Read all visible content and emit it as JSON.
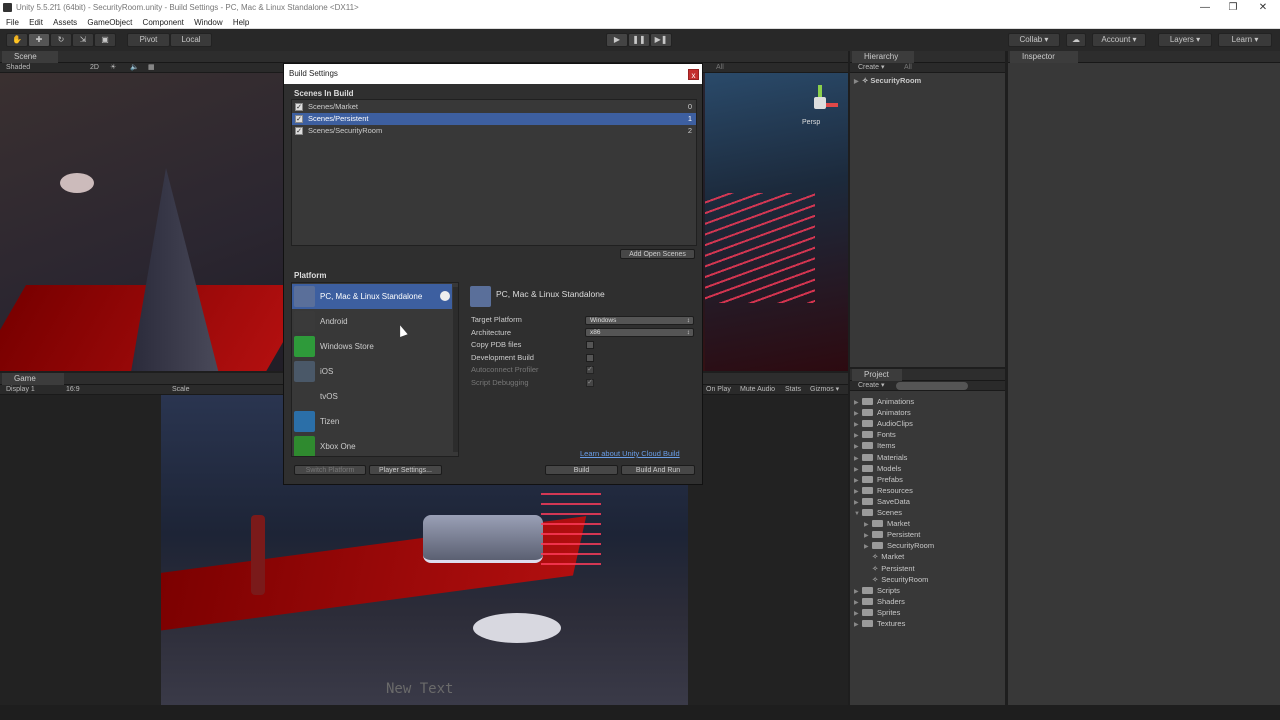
{
  "window": {
    "title": "Unity 5.5.2f1 (64bit) - SecurityRoom.unity - Build Settings - PC, Mac & Linux Standalone <DX11>",
    "minimize_icon": "minimize-icon",
    "maximize_icon": "restore-icon",
    "close_icon": "close-icon"
  },
  "menu": [
    "File",
    "Edit",
    "Assets",
    "GameObject",
    "Component",
    "Window",
    "Help"
  ],
  "toolbar": {
    "tool_icons": [
      "hand-icon",
      "move-icon",
      "rotate-icon",
      "scale-icon",
      "rect-tool-icon"
    ],
    "pivot_label": "Pivot",
    "local_label": "Local",
    "play_icon": "▶",
    "pause_icon": "❚❚",
    "step_icon": "▶❚",
    "collab_label": "Collab ▾",
    "account_label": "Account",
    "layers_label": "Layers",
    "layout_label": "Learn"
  },
  "scene_view": {
    "tab_label": "Scene",
    "shading": "Shaded",
    "mode_2d": "2D",
    "search_placeholder": "All",
    "persp_label": "Persp"
  },
  "game_view": {
    "tab_label": "Game",
    "display": "Display 1",
    "aspect": "16:9",
    "scale_label": "Scale",
    "options": [
      "Maximize On Play",
      "Mute Audio",
      "Stats",
      "Gizmos"
    ],
    "options_visible": [
      "On Play",
      "Mute Audio",
      "Stats",
      "Gizmos ▾"
    ],
    "overlay_text": "New Text"
  },
  "hierarchy": {
    "tab_label": "Hierarchy",
    "create_label": "Create ▾",
    "search_placeholder": "All",
    "root_item": "SecurityRoom"
  },
  "inspector": {
    "tab_label": "Inspector"
  },
  "project": {
    "tab_label": "Project",
    "create_label": "Create ▾",
    "items": [
      {
        "label": "Animations",
        "indent": 0,
        "type": "folder",
        "arrow": "▶"
      },
      {
        "label": "Animators",
        "indent": 0,
        "type": "folder",
        "arrow": "▶"
      },
      {
        "label": "AudioClips",
        "indent": 0,
        "type": "folder",
        "arrow": "▶"
      },
      {
        "label": "Fonts",
        "indent": 0,
        "type": "folder",
        "arrow": "▶"
      },
      {
        "label": "Items",
        "indent": 0,
        "type": "folder",
        "arrow": "▶"
      },
      {
        "label": "Materials",
        "indent": 0,
        "type": "folder",
        "arrow": "▶"
      },
      {
        "label": "Models",
        "indent": 0,
        "type": "folder",
        "arrow": "▶"
      },
      {
        "label": "Prefabs",
        "indent": 0,
        "type": "folder",
        "arrow": "▶"
      },
      {
        "label": "Resources",
        "indent": 0,
        "type": "folder",
        "arrow": "▶"
      },
      {
        "label": "SaveData",
        "indent": 0,
        "type": "folder",
        "arrow": "▶"
      },
      {
        "label": "Scenes",
        "indent": 0,
        "type": "folder",
        "arrow": "▼"
      },
      {
        "label": "Market",
        "indent": 1,
        "type": "folder",
        "arrow": "▶"
      },
      {
        "label": "Persistent",
        "indent": 1,
        "type": "folder",
        "arrow": "▶"
      },
      {
        "label": "SecurityRoom",
        "indent": 1,
        "type": "folder",
        "arrow": "▶"
      },
      {
        "label": "Market",
        "indent": 1,
        "type": "scene",
        "arrow": ""
      },
      {
        "label": "Persistent",
        "indent": 1,
        "type": "scene",
        "arrow": ""
      },
      {
        "label": "SecurityRoom",
        "indent": 1,
        "type": "scene",
        "arrow": ""
      },
      {
        "label": "Scripts",
        "indent": 0,
        "type": "folder",
        "arrow": "▶"
      },
      {
        "label": "Shaders",
        "indent": 0,
        "type": "folder",
        "arrow": "▶"
      },
      {
        "label": "Sprites",
        "indent": 0,
        "type": "folder",
        "arrow": "▶"
      },
      {
        "label": "Textures",
        "indent": 0,
        "type": "folder",
        "arrow": "▶"
      }
    ]
  },
  "build_settings": {
    "title": "Build Settings",
    "close_label": "x",
    "scenes_header": "Scenes In Build",
    "scenes": [
      {
        "name": "Scenes/Market",
        "index": "0",
        "checked": true,
        "selected": false
      },
      {
        "name": "Scenes/Persistent",
        "index": "1",
        "checked": true,
        "selected": true
      },
      {
        "name": "Scenes/SecurityRoom",
        "index": "2",
        "checked": true,
        "selected": false
      }
    ],
    "add_open_scenes": "Add Open Scenes",
    "platform_header": "Platform",
    "platforms": [
      {
        "name": "PC, Mac & Linux Standalone",
        "icon": "unity-standalone-icon",
        "color": "#5a6f9a",
        "selected": true
      },
      {
        "name": "Android",
        "icon": "android-phone-icon",
        "color": "#3a3a3a",
        "selected": false
      },
      {
        "name": "Windows Store",
        "icon": "windows-store-icon",
        "color": "#2e9a3a",
        "selected": false
      },
      {
        "name": "iOS",
        "icon": "ios-device-icon",
        "color": "#4a5868",
        "selected": false
      },
      {
        "name": "tvOS",
        "icon": "apple-tv-icon",
        "color": "#383838",
        "selected": false
      },
      {
        "name": "Tizen",
        "icon": "tizen-icon",
        "color": "#2b6fa8",
        "selected": false
      },
      {
        "name": "Xbox One",
        "icon": "xbox-icon",
        "color": "#2f8a2f",
        "selected": false
      }
    ],
    "selected_platform_title": "PC, Mac & Linux Standalone",
    "settings": [
      {
        "label": "Target Platform",
        "kind": "dropdown",
        "value": "Windows",
        "enabled": true
      },
      {
        "label": "Architecture",
        "kind": "dropdown",
        "value": "x86",
        "enabled": true
      },
      {
        "label": "Copy PDB files",
        "kind": "checkbox",
        "checked": false,
        "enabled": true
      },
      {
        "label": "Development Build",
        "kind": "checkbox",
        "checked": false,
        "enabled": true
      },
      {
        "label": "Autoconnect Profiler",
        "kind": "checkbox",
        "checked": true,
        "enabled": false
      },
      {
        "label": "Script Debugging",
        "kind": "checkbox",
        "checked": true,
        "enabled": false
      }
    ],
    "cloud_link": "Learn about Unity Cloud Build",
    "switch_platform": "Switch Platform",
    "player_settings": "Player Settings...",
    "build": "Build",
    "build_and_run": "Build And Run"
  },
  "colors": {
    "accent": "#3d5fa0",
    "panel": "#2f2f2f",
    "link": "#6a9ee8",
    "neon_red": "#ff3b5a"
  }
}
